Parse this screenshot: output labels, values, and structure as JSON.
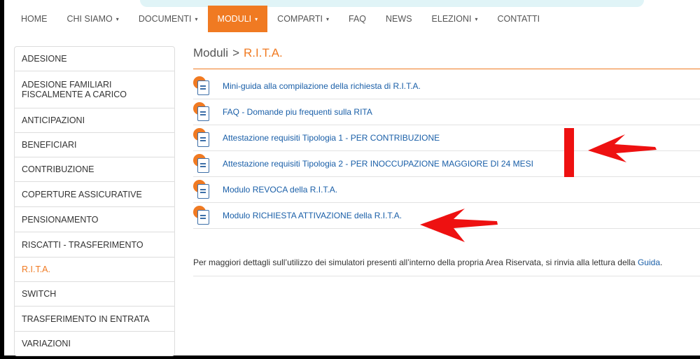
{
  "nav": {
    "items": [
      {
        "label": "HOME",
        "caret": false,
        "active": false
      },
      {
        "label": "CHI SIAMO",
        "caret": true,
        "active": false
      },
      {
        "label": "DOCUMENTI",
        "caret": true,
        "active": false
      },
      {
        "label": "MODULI",
        "caret": true,
        "active": true
      },
      {
        "label": "COMPARTI",
        "caret": true,
        "active": false
      },
      {
        "label": "FAQ",
        "caret": false,
        "active": false
      },
      {
        "label": "NEWS",
        "caret": false,
        "active": false
      },
      {
        "label": "ELEZIONI",
        "caret": true,
        "active": false
      },
      {
        "label": "CONTATTI",
        "caret": false,
        "active": false
      }
    ],
    "caret_glyph": "▾"
  },
  "sidebar": {
    "items": [
      {
        "label": "ADESIONE",
        "active": false
      },
      {
        "label": "ADESIONE FAMILIARI FISCALMENTE A CARICO",
        "active": false
      },
      {
        "label": "ANTICIPAZIONI",
        "active": false
      },
      {
        "label": "BENEFICIARI",
        "active": false
      },
      {
        "label": "CONTRIBUZIONE",
        "active": false
      },
      {
        "label": "COPERTURE ASSICURATIVE",
        "active": false
      },
      {
        "label": "PENSIONAMENTO",
        "active": false
      },
      {
        "label": "RISCATTI - TRASFERIMENTO",
        "active": false
      },
      {
        "label": "R.I.T.A.",
        "active": true
      },
      {
        "label": "SWITCH",
        "active": false
      },
      {
        "label": "TRASFERIMENTO IN ENTRATA",
        "active": false
      },
      {
        "label": "VARIAZIONI",
        "active": false
      }
    ]
  },
  "breadcrumb": {
    "parent": "Moduli",
    "separator": ">",
    "current": "R.I.T.A."
  },
  "documents": [
    {
      "label": "Mini-guida alla compilazione della richiesta di R.I.T.A.",
      "icon": "document-icon"
    },
    {
      "label": "FAQ - Domande piu frequenti sulla RITA",
      "icon": "document-icon"
    },
    {
      "label": "Attestazione requisiti Tipologia 1 - PER CONTRIBUZIONE",
      "icon": "document-icon"
    },
    {
      "label": "Attestazione requisiti Tipologia 2 - PER INOCCUPAZIONE MAGGIORE DI 24 MESI",
      "icon": "document-icon"
    },
    {
      "label": "Modulo REVOCA della R.I.T.A.",
      "icon": "document-icon"
    },
    {
      "label": "Modulo RICHIESTA ATTIVAZIONE della R.I.T.A.",
      "icon": "document-icon"
    }
  ],
  "info": {
    "text": "Per maggiori dettagli sull’utilizzo dei simulatori presenti all’interno della propria Area Riservata, si rinvia alla lettura della ",
    "link": "Guida",
    "end": "."
  },
  "colors": {
    "accent": "#f07a22",
    "link": "#1a5fa8",
    "annotation": "#ee1111"
  }
}
